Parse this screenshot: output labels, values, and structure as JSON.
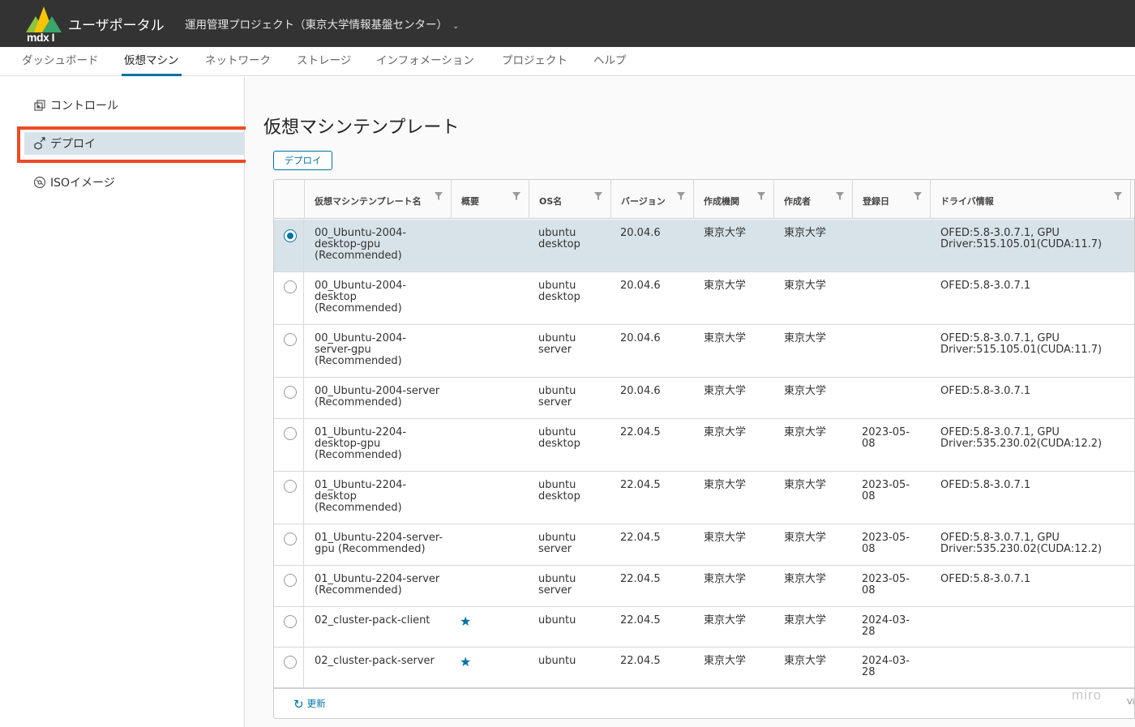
{
  "header": {
    "logo_text": "mdx I",
    "app_title": "ユーザポータル",
    "project": "運用管理プロジェクト（東京大学情報基盤センター）"
  },
  "topnav": [
    {
      "label": "ダッシュボード"
    },
    {
      "label": "仮想マシン",
      "active": true
    },
    {
      "label": "ネットワーク"
    },
    {
      "label": "ストレージ"
    },
    {
      "label": "インフォメーション"
    },
    {
      "label": "プロジェクト"
    },
    {
      "label": "ヘルプ"
    }
  ],
  "sidebar": {
    "items": [
      {
        "label": "コントロール",
        "icon": "control-icon"
      },
      {
        "label": "デプロイ",
        "icon": "deploy-icon",
        "active": true
      },
      {
        "label": "ISOイメージ",
        "icon": "disc-icon"
      }
    ]
  },
  "main": {
    "title": "仮想マシンテンプレート",
    "deploy_button": "デプロイ",
    "refresh_label": "更新"
  },
  "table": {
    "columns": [
      "仮想マシンテンプレート名",
      "概要",
      "OS名",
      "バージョン",
      "作成機関",
      "作成者",
      "登録日",
      "ドライバ情報"
    ],
    "rows": [
      {
        "name": "00_Ubuntu-2004-\ndesktop-gpu\n(Recommended)",
        "summary_star": false,
        "os": "ubuntu\ndesktop",
        "version": "20.04.6",
        "org": "東京大学",
        "author": "東京大学",
        "date": "",
        "driver": "OFED:5.8-3.0.7.1, GPU\nDriver:515.105.01(CUDA:11.7)",
        "selected": true
      },
      {
        "name": "00_Ubuntu-2004-\ndesktop\n(Recommended)",
        "summary_star": false,
        "os": "ubuntu\ndesktop",
        "version": "20.04.6",
        "org": "東京大学",
        "author": "東京大学",
        "date": "",
        "driver": "OFED:5.8-3.0.7.1",
        "selected": false
      },
      {
        "name": "00_Ubuntu-2004-\nserver-gpu\n(Recommended)",
        "summary_star": false,
        "os": "ubuntu\nserver",
        "version": "20.04.6",
        "org": "東京大学",
        "author": "東京大学",
        "date": "",
        "driver": "OFED:5.8-3.0.7.1, GPU\nDriver:515.105.01(CUDA:11.7)",
        "selected": false
      },
      {
        "name": "00_Ubuntu-2004-server\n(Recommended)",
        "summary_star": false,
        "os": "ubuntu\nserver",
        "version": "20.04.6",
        "org": "東京大学",
        "author": "東京大学",
        "date": "",
        "driver": "OFED:5.8-3.0.7.1",
        "selected": false
      },
      {
        "name": "01_Ubuntu-2204-\ndesktop-gpu\n(Recommended)",
        "summary_star": false,
        "os": "ubuntu\ndesktop",
        "version": "22.04.5",
        "org": "東京大学",
        "author": "東京大学",
        "date": "2023-05-\n08",
        "driver": "OFED:5.8-3.0.7.1, GPU\nDriver:535.230.02(CUDA:12.2)",
        "selected": false
      },
      {
        "name": "01_Ubuntu-2204-\ndesktop\n(Recommended)",
        "summary_star": false,
        "os": "ubuntu\ndesktop",
        "version": "22.04.5",
        "org": "東京大学",
        "author": "東京大学",
        "date": "2023-05-\n08",
        "driver": "OFED:5.8-3.0.7.1",
        "selected": false
      },
      {
        "name": "01_Ubuntu-2204-server-\ngpu (Recommended)",
        "summary_star": false,
        "os": "ubuntu\nserver",
        "version": "22.04.5",
        "org": "東京大学",
        "author": "東京大学",
        "date": "2023-05-\n08",
        "driver": "OFED:5.8-3.0.7.1, GPU\nDriver:535.230.02(CUDA:12.2)",
        "selected": false
      },
      {
        "name": "01_Ubuntu-2204-server\n(Recommended)",
        "summary_star": false,
        "os": "ubuntu\nserver",
        "version": "22.04.5",
        "org": "東京大学",
        "author": "東京大学",
        "date": "2023-05-\n08",
        "driver": "OFED:5.8-3.0.7.1",
        "selected": false
      },
      {
        "name": "02_cluster-pack-client",
        "summary_star": true,
        "os": "ubuntu",
        "version": "22.04.5",
        "org": "東京大学",
        "author": "東京大学",
        "date": "2024-03-\n28",
        "driver": "",
        "selected": false
      },
      {
        "name": "02_cluster-pack-server",
        "summary_star": true,
        "os": "ubuntu",
        "version": "22.04.5",
        "org": "東京大学",
        "author": "東京大学",
        "date": "2024-03-\n28",
        "driver": "",
        "selected": false
      }
    ]
  },
  "overlay": {
    "watermark": "miro",
    "corner_text": "Vi"
  },
  "colors": {
    "header_bg": "#333333",
    "accent": "#0072a3",
    "selected_row": "#d8e3e9",
    "highlight": "#ef4a24"
  }
}
